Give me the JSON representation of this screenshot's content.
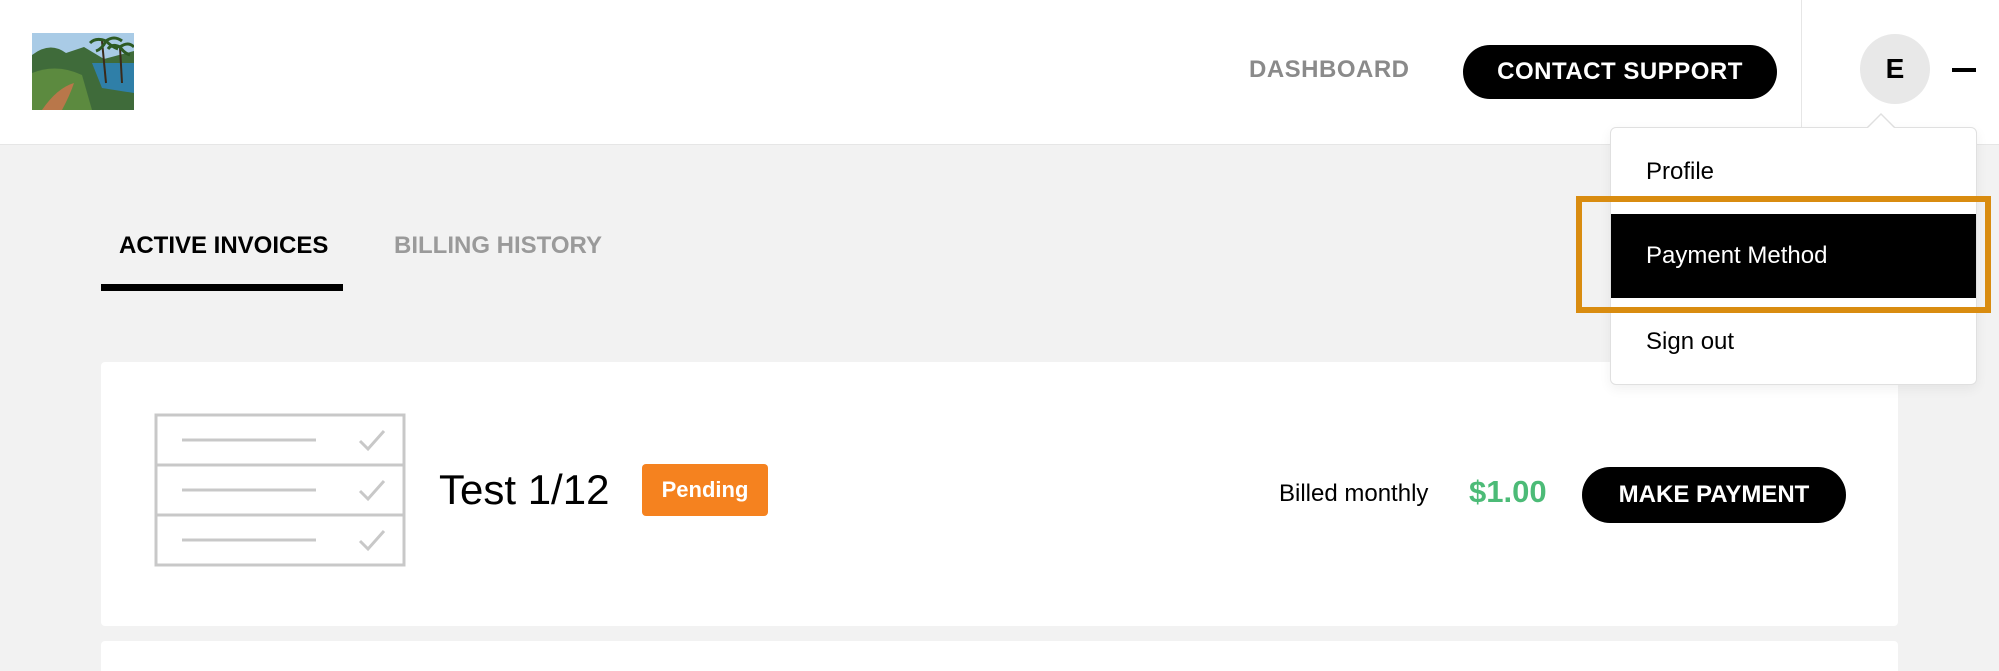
{
  "header": {
    "logo_alt": "Coastal trail photo",
    "nav_dashboard": "DASHBOARD",
    "contact_support": "CONTACT SUPPORT",
    "avatar_initial": "E",
    "menu_icon": "minus-icon"
  },
  "tabs": [
    {
      "label": "ACTIVE INVOICES",
      "active": true
    },
    {
      "label": "BILLING HISTORY",
      "active": false
    }
  ],
  "invoice": {
    "icon": "checklist-icon",
    "title": "Test 1/12",
    "status": "Pending",
    "billing_cycle": "Billed monthly",
    "amount": "$1.00",
    "pay_button": "MAKE PAYMENT"
  },
  "dropdown": {
    "items": [
      {
        "label": "Profile",
        "selected": false
      },
      {
        "label": "Payment Method",
        "selected": true
      },
      {
        "label": "Sign out",
        "selected": false
      }
    ]
  },
  "colors": {
    "accent_black": "#000000",
    "pending_orange": "#f5821f",
    "amount_green": "#4cbb77",
    "highlight_outline": "#d98c10",
    "page_background": "#f2f2f2"
  }
}
